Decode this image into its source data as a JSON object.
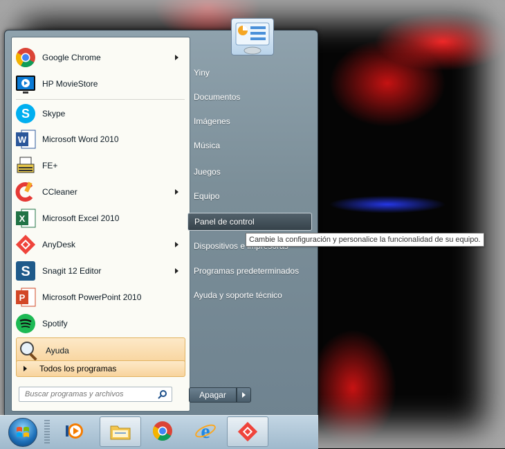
{
  "start_menu": {
    "programs": [
      {
        "label": "Google Chrome",
        "icon": "chrome-icon",
        "has_submenu": true
      },
      {
        "label": "HP MovieStore",
        "icon": "hp-moviestore-icon",
        "has_submenu": false
      },
      {
        "label": "Skype",
        "icon": "skype-icon",
        "has_submenu": false
      },
      {
        "label": "Microsoft Word 2010",
        "icon": "word-icon",
        "has_submenu": false
      },
      {
        "label": "FE+",
        "icon": "fe-plus-icon",
        "has_submenu": false
      },
      {
        "label": "CCleaner",
        "icon": "ccleaner-icon",
        "has_submenu": true
      },
      {
        "label": "Microsoft Excel 2010",
        "icon": "excel-icon",
        "has_submenu": false
      },
      {
        "label": "AnyDesk",
        "icon": "anydesk-icon",
        "has_submenu": true
      },
      {
        "label": "Snagit 12 Editor",
        "icon": "snagit-icon",
        "has_submenu": true
      },
      {
        "label": "Microsoft PowerPoint 2010",
        "icon": "powerpoint-icon",
        "has_submenu": false
      },
      {
        "label": "Spotify",
        "icon": "spotify-icon",
        "has_submenu": false
      },
      {
        "label": "Ayuda",
        "icon": "magnifier-icon",
        "has_submenu": false
      }
    ],
    "all_programs_label": "Todos los programas",
    "search_placeholder": "Buscar programas y archivos",
    "right_items": [
      {
        "label": "Yiny"
      },
      {
        "label": "Documentos"
      },
      {
        "label": "Imágenes"
      },
      {
        "label": "Música"
      },
      {
        "label": "Juegos"
      },
      {
        "label": "Equipo"
      },
      {
        "label": "Panel de control"
      },
      {
        "label": "Dispositivos e impresoras"
      },
      {
        "label": "Programas predeterminados"
      },
      {
        "label": "Ayuda y soporte técnico"
      }
    ],
    "selected_right_item": "Panel de control",
    "shutdown_label": "Apagar"
  },
  "tooltip": {
    "text": "Cambie la configuración y personalice la funcionalidad de su equipo."
  },
  "taskbar": {
    "buttons": [
      {
        "icon": "media-player-icon"
      },
      {
        "icon": "file-explorer-icon",
        "active": true
      },
      {
        "icon": "chrome-icon"
      },
      {
        "icon": "internet-explorer-icon"
      },
      {
        "icon": "anydesk-icon",
        "active": true
      }
    ]
  },
  "colors": {
    "menu_highlight": "#f8d49d",
    "menu_frame": "#7c8f99",
    "left_pane_bg": "#fbfbf5"
  }
}
